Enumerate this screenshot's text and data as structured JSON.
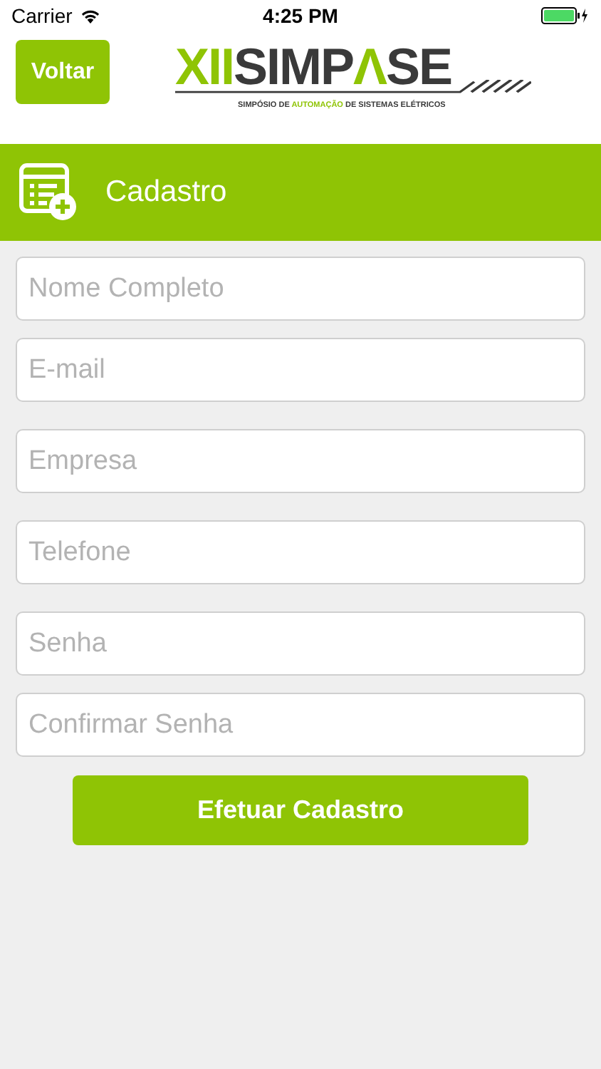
{
  "status_bar": {
    "carrier": "Carrier",
    "time": "4:25 PM"
  },
  "header": {
    "back_button": "Voltar",
    "logo": {
      "title_parts": [
        {
          "text": "XII",
          "accent": true
        },
        {
          "text": "SIMP",
          "accent": false
        },
        {
          "text": "Λ",
          "accent": true
        },
        {
          "text": "SE",
          "accent": false
        }
      ],
      "subtitle_parts": [
        {
          "text": "SIMPÓSIO DE ",
          "accent": false
        },
        {
          "text": "AUTOMAÇÃO",
          "accent": true
        },
        {
          "text": " DE SISTEMAS ELÉTRICOS",
          "accent": false
        }
      ]
    }
  },
  "section": {
    "title": "Cadastro"
  },
  "fields": [
    {
      "placeholder": "Nome Completo"
    },
    {
      "placeholder": "E-mail"
    },
    {
      "placeholder": "Empresa"
    },
    {
      "placeholder": "Telefone"
    },
    {
      "placeholder": "Senha"
    },
    {
      "placeholder": "Confirmar Senha"
    }
  ],
  "submit_button": "Efetuar Cadastro"
}
